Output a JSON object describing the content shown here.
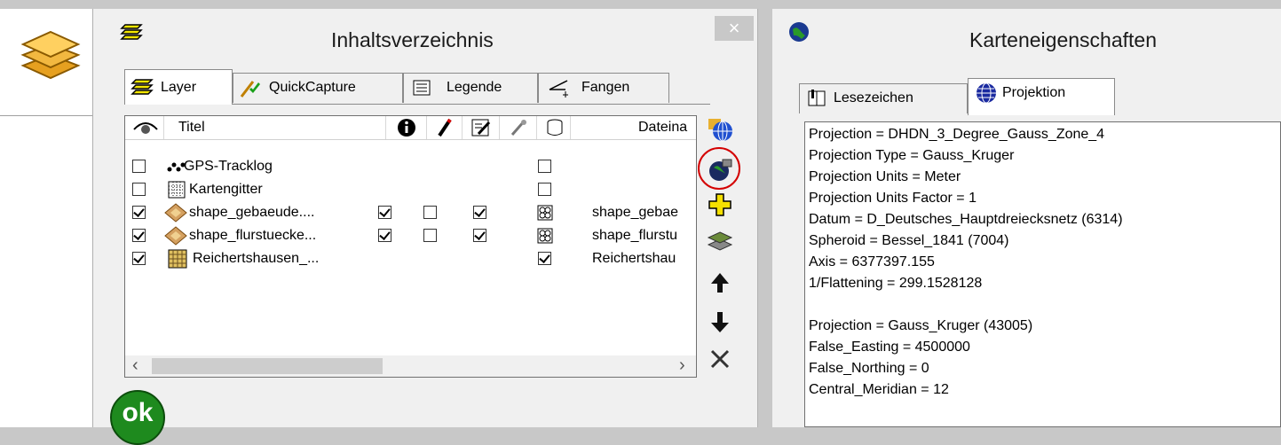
{
  "left_window": {
    "title": "Inhaltsverzeichnis",
    "close_label": "×",
    "tabs": [
      {
        "label": "Layer",
        "selected": true
      },
      {
        "label": "QuickCapture",
        "selected": false
      },
      {
        "label": "Legende",
        "selected": false
      },
      {
        "label": "Fangen",
        "selected": false
      }
    ],
    "columns": [
      "Titel",
      "Dateina"
    ],
    "layers": [
      {
        "title": "GPS-Tracklog",
        "visible": false,
        "info": null,
        "edit": null,
        "edit2": null,
        "snap": false,
        "file": ""
      },
      {
        "title": "Kartengitter",
        "visible": false,
        "info": null,
        "edit": null,
        "edit2": null,
        "snap": false,
        "file": ""
      },
      {
        "title": "shape_gebaeude....",
        "visible": true,
        "info": true,
        "edit": false,
        "edit2": true,
        "snap": "pattern",
        "file": "shape_gebae"
      },
      {
        "title": "shape_flurstuecke...",
        "visible": true,
        "info": true,
        "edit": false,
        "edit2": true,
        "snap": "pattern",
        "file": "shape_flurstu"
      },
      {
        "title": "Reichertshausen_...",
        "visible": true,
        "info": null,
        "edit": null,
        "edit2": null,
        "snap": true,
        "file": "Reichertshau"
      }
    ],
    "scroll_left": "‹",
    "scroll_right": "›",
    "ok_label": "ok"
  },
  "right_window": {
    "title": "Karteneigenschaften",
    "tabs": [
      {
        "label": "Lesezeichen",
        "selected": false
      },
      {
        "label": "Projektion",
        "selected": true
      }
    ],
    "projection_lines": [
      "Projection = DHDN_3_Degree_Gauss_Zone_4",
      "Projection Type = Gauss_Kruger",
      "Projection Units = Meter",
      "Projection Units Factor = 1",
      "Datum = D_Deutsches_Hauptdreiecksnetz (6314)",
      "Spheroid = Bessel_1841 (7004)",
      "Axis = 6377397.155",
      "1/Flattening = 299.1528128",
      "",
      "Projection = Gauss_Kruger (43005)",
      "False_Easting = 4500000",
      "False_Northing = 0",
      "Central_Meridian = 12"
    ]
  },
  "colors": {
    "highlight_circle": "#d40000",
    "ok_green": "#1e8a1e"
  }
}
